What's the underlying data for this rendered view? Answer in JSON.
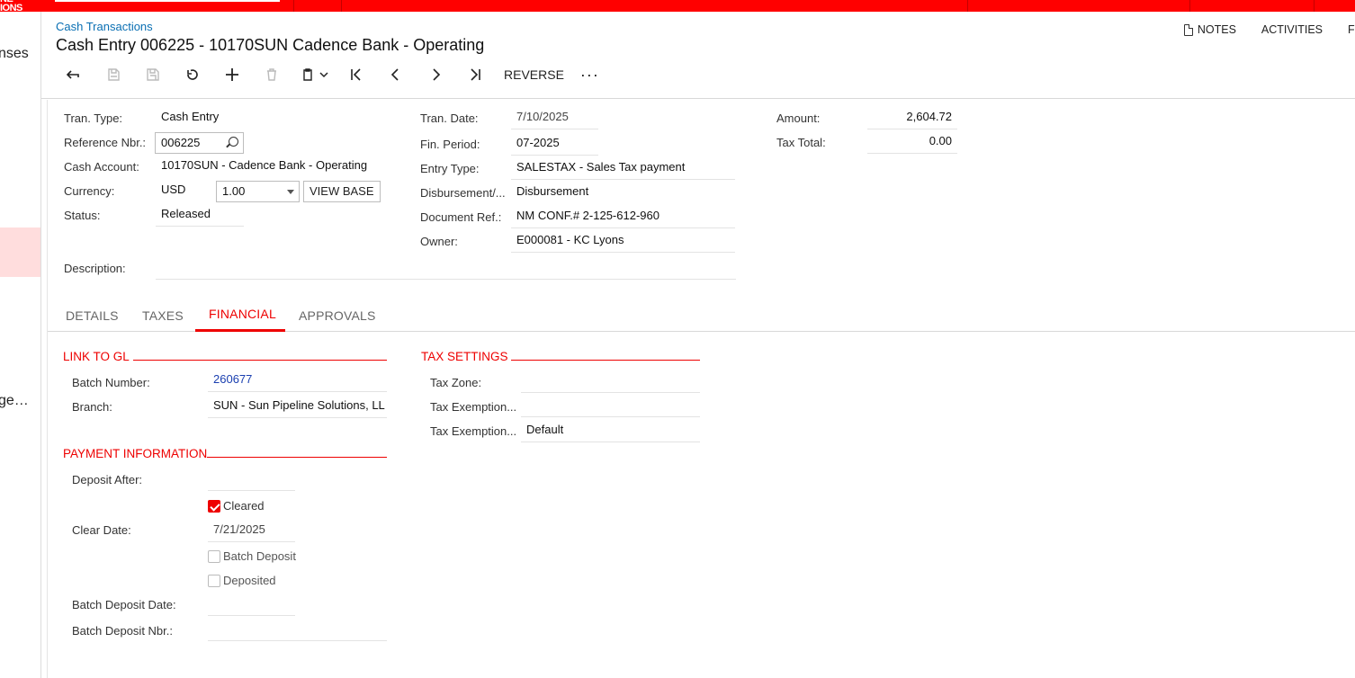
{
  "topbar": {
    "logo_fragment": "NE\nIONS"
  },
  "sidebar": {
    "fragments": [
      "nses",
      "ge…"
    ]
  },
  "header": {
    "breadcrumb": "Cash Transactions",
    "title": "Cash Entry 006225 - 10170SUN Cadence Bank - Operating",
    "links": {
      "notes": "NOTES",
      "activities": "ACTIVITIES",
      "files": "F"
    }
  },
  "toolbar": {
    "reverse_label": "REVERSE",
    "more_label": "···"
  },
  "form": {
    "tran_type": {
      "label": "Tran. Type:",
      "value": "Cash Entry"
    },
    "reference_nbr": {
      "label": "Reference Nbr.:",
      "value": "006225"
    },
    "cash_account": {
      "label": "Cash Account:",
      "value": "10170SUN - Cadence Bank - Operating"
    },
    "currency": {
      "label": "Currency:",
      "value": "USD",
      "rate": "1.00",
      "view_base": "VIEW BASE"
    },
    "status": {
      "label": "Status:",
      "value": "Released"
    },
    "description": {
      "label": "Description:",
      "value": ""
    },
    "tran_date": {
      "label": "Tran. Date:",
      "value": "7/10/2025"
    },
    "fin_period": {
      "label": "Fin. Period:",
      "value": "07-2025"
    },
    "entry_type": {
      "label": "Entry Type:",
      "value": "SALESTAX - Sales Tax payment"
    },
    "disbursement": {
      "label": "Disbursement/...",
      "value": "Disbursement"
    },
    "document_ref": {
      "label": "Document Ref.:",
      "value": "NM CONF.# 2-125-612-960"
    },
    "owner": {
      "label": "Owner:",
      "value": "E000081 - KC Lyons"
    },
    "amount": {
      "label": "Amount:",
      "value": "2,604.72"
    },
    "tax_total": {
      "label": "Tax Total:",
      "value": "0.00"
    }
  },
  "tabs": [
    "DETAILS",
    "TAXES",
    "FINANCIAL",
    "APPROVALS"
  ],
  "financial": {
    "link_to_gl": {
      "title": "LINK TO GL",
      "batch_number": {
        "label": "Batch Number:",
        "value": "260677"
      },
      "branch": {
        "label": "Branch:",
        "value": "SUN - Sun Pipeline Solutions, LL"
      }
    },
    "tax_settings": {
      "title": "TAX SETTINGS",
      "tax_zone": {
        "label": "Tax Zone:",
        "value": ""
      },
      "tax_exemption_1": {
        "label": "Tax Exemption...",
        "value": ""
      },
      "tax_exemption_2": {
        "label": "Tax Exemption...",
        "value": "Default"
      }
    },
    "payment_information": {
      "title": "PAYMENT INFORMATION",
      "deposit_after": {
        "label": "Deposit After:",
        "value": ""
      },
      "cleared": {
        "label": "Cleared",
        "checked": true
      },
      "clear_date": {
        "label": "Clear Date:",
        "value": "7/21/2025"
      },
      "batch_deposit": {
        "label": "Batch Deposit",
        "checked": false
      },
      "deposited": {
        "label": "Deposited",
        "checked": false
      },
      "batch_deposit_date": {
        "label": "Batch Deposit Date:",
        "value": ""
      },
      "batch_deposit_nbr": {
        "label": "Batch Deposit Nbr.:",
        "value": ""
      }
    }
  },
  "colors": {
    "accent": "#ff0000",
    "link": "#0a6fb3"
  }
}
